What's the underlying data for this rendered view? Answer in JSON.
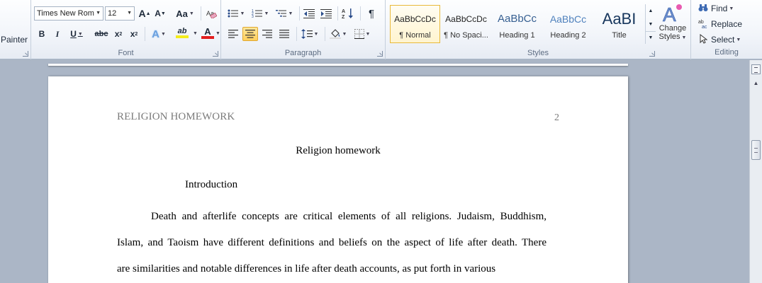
{
  "ribbon": {
    "clipboard": {
      "format_painter_label": "Painter"
    },
    "font": {
      "group_label": "Font",
      "font_name": "Times New Rom",
      "font_size": "12",
      "grow_font": "A",
      "shrink_font": "A",
      "change_case": "Aa",
      "bold": "B",
      "italic": "I",
      "underline": "U",
      "strikethrough": "abc",
      "subscript": "x",
      "superscript": "x",
      "text_effects": "A",
      "highlight": "ab",
      "font_color": "A",
      "highlight_color": "#f4ec1c",
      "font_color_value": "#e21e1e"
    },
    "paragraph": {
      "group_label": "Paragraph",
      "show_marks": "¶"
    },
    "styles": {
      "group_label": "Styles",
      "tiles": [
        {
          "sample": "AaBbCcDc",
          "name": "¶ Normal"
        },
        {
          "sample": "AaBbCcDc",
          "name": "¶ No Spaci..."
        },
        {
          "sample": "AaBbCc",
          "name": "Heading 1"
        },
        {
          "sample": "AaBbCc",
          "name": "Heading 2"
        },
        {
          "sample": "AaBI",
          "name": "Title"
        }
      ],
      "change_styles_line1": "Change",
      "change_styles_line2": "Styles"
    },
    "editing": {
      "group_label": "Editing",
      "find": "Find",
      "replace": "Replace",
      "select": "Select"
    }
  },
  "document": {
    "header_text": "RELIGION HOMEWORK",
    "page_number": "2",
    "title": "Religion homework",
    "section_heading": "Introduction",
    "paragraph_lines": [
      "Death and afterlife concepts are critical elements of all religions. Judaism, Buddhism,",
      "Islam, and Taoism have different definitions and beliefs on the aspect of life after death. There",
      "are similarities and notable differences in life after death accounts, as put forth in various"
    ]
  },
  "colors": {
    "active_style_border": "#e8b93a",
    "heading_blue": "#365f91",
    "workspace": "#abb6c6"
  }
}
